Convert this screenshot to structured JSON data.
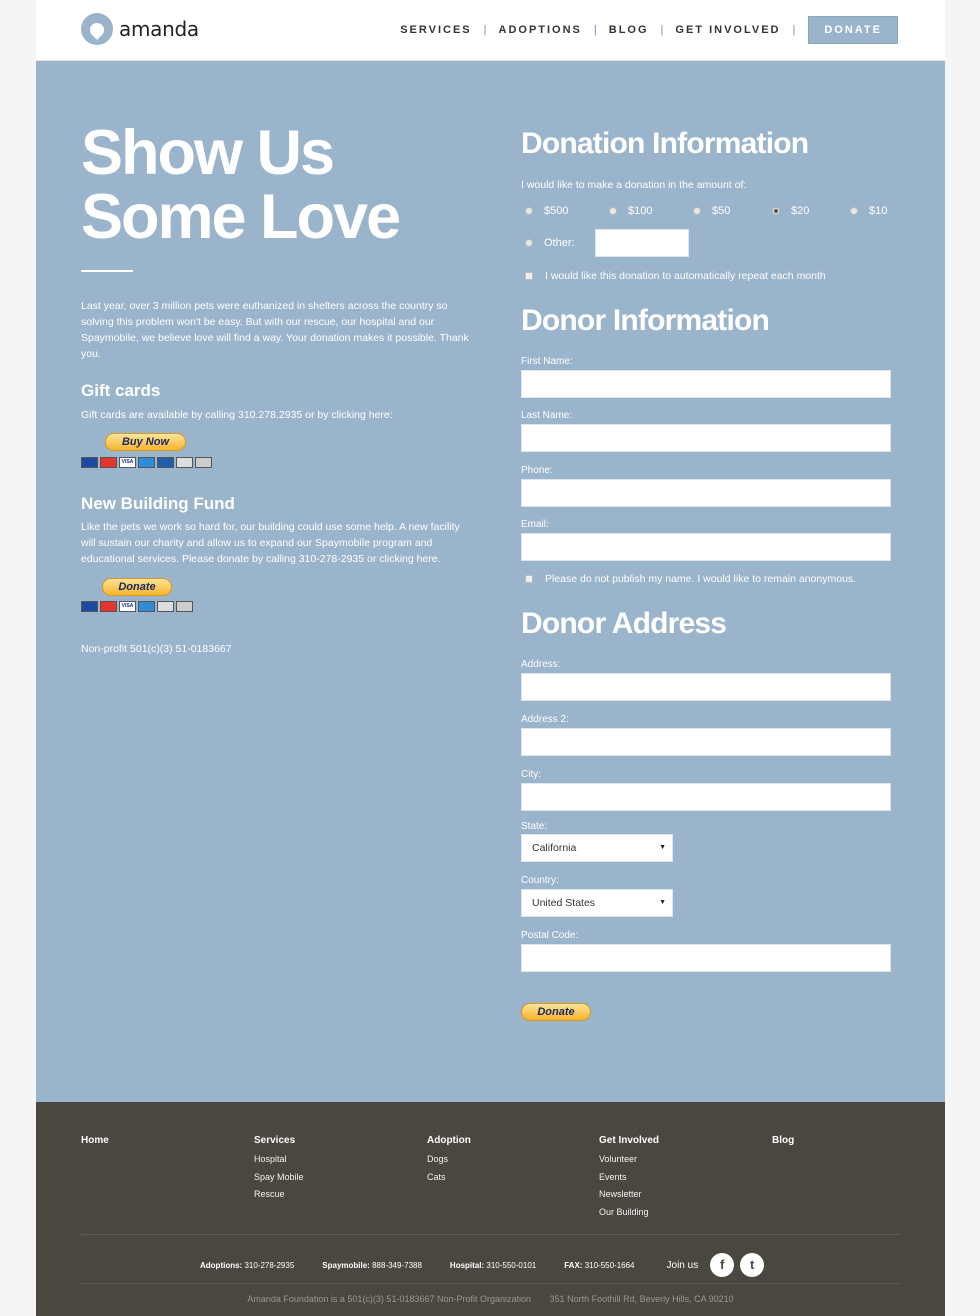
{
  "brand": {
    "name": "amanda",
    "color": "#9ab4cb"
  },
  "nav": {
    "items": [
      "SERVICES",
      "ADOPTIONS",
      "BLOG",
      "GET INVOLVED"
    ],
    "separator": "|",
    "donate": "DONATE"
  },
  "hero": {
    "line1": "Show Us",
    "line2": "Some Love"
  },
  "intro": "Last year, over 3 million pets were euthanized in shelters across the country so solving this problem won't be easy. But with our rescue, our hospital and our Spaymobile, we believe love will find a way. Your donation makes it possible. Thank you.",
  "gift": {
    "title": "Gift cards",
    "text": "Gift cards are available by calling 310.278.2935 or by clicking here:",
    "button": "Buy Now"
  },
  "building": {
    "title": "New Building Fund",
    "text": "Like the pets we work so hard for, our building could use some help. A new facility will sustain our charity and allow us to expand our Spaymobile program and educational services. Please donate by calling 310-278-2935 or clicking here.",
    "button": "Donate"
  },
  "card_icons": [
    "maestro-icon",
    "mastercard-icon",
    "visa-icon",
    "amex-icon",
    "amex-blue-icon",
    "discover-icon",
    "bank-icon"
  ],
  "nonprofit": "Non-profit 501(c)(3) 51-0183667",
  "donation": {
    "title": "Donation Information",
    "prompt": "I would like to make a donation in the amount of:",
    "amounts": [
      "$500",
      "$100",
      "$50",
      "$20",
      "$10"
    ],
    "selected": "$20",
    "other_label": "Other:",
    "other_value": "",
    "repeat_label": "I would like this donation to automatically repeat each month"
  },
  "donor": {
    "title": "Donor Information",
    "first_name": "First Name:",
    "last_name": "Last Name:",
    "phone": "Phone:",
    "email": "Email:",
    "anonymous": "Please do not publish my name. I would like to remain anonymous."
  },
  "address": {
    "title": "Donor Address",
    "address": "Address:",
    "address2": "Address 2:",
    "city": "City:",
    "state_label": "State:",
    "state_value": "California",
    "country_label": "Country:",
    "country_value": "United States",
    "postal": "Postal Code:",
    "submit": "Donate"
  },
  "footer": {
    "columns": [
      {
        "title": "Home",
        "links": []
      },
      {
        "title": "Services",
        "links": [
          "Hospital",
          "Spay Mobile",
          "Rescue"
        ]
      },
      {
        "title": "Adoption",
        "links": [
          "Dogs",
          "Cats"
        ]
      },
      {
        "title": "Get Involved",
        "links": [
          "Volunteer",
          "Events",
          "Newsletter",
          "Our Building"
        ]
      },
      {
        "title": "Blog",
        "links": []
      }
    ],
    "contacts": [
      {
        "label": "Adoptions:",
        "value": "310-278-2935"
      },
      {
        "label": "Spaymobile:",
        "value": "888-349-7388"
      },
      {
        "label": "Hospital:",
        "value": "310-550-0101"
      },
      {
        "label": "FAX:",
        "value": "310-550-1664"
      }
    ],
    "join": "Join us",
    "social": [
      "f",
      "t"
    ],
    "legal1": "Amanda Foundation is a 501(c)(3) 51-0183667 Non-Profit Organization",
    "legal2": "351 North Foothill Rd, Beverly Hills, CA 90210"
  }
}
